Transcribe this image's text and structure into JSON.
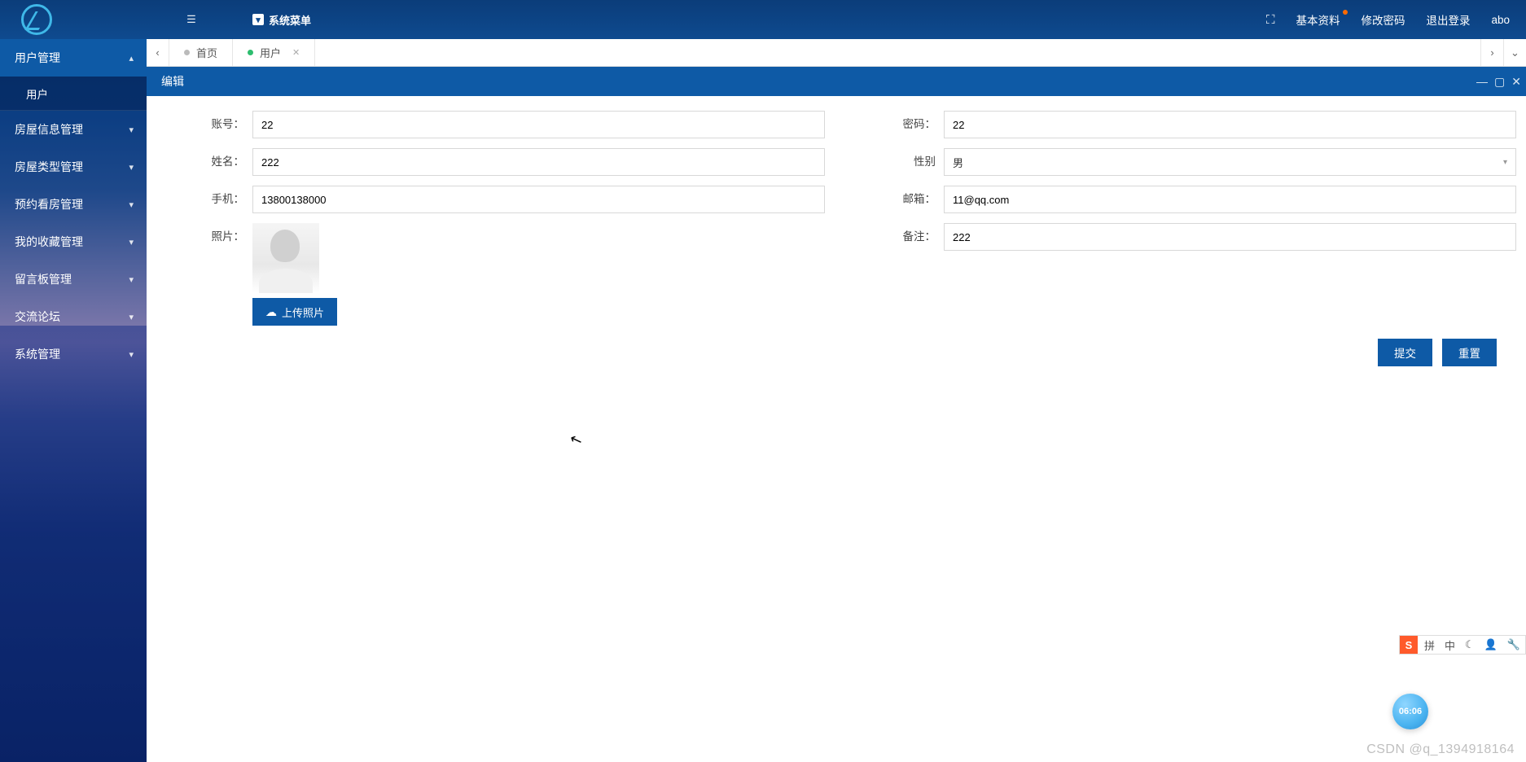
{
  "header": {
    "system_menu": "系统菜单",
    "links": {
      "profile": "基本资料",
      "change_pwd": "修改密码",
      "logout": "退出登录",
      "user": "abo"
    }
  },
  "sidebar": {
    "items": [
      {
        "label": "用户管理",
        "expanded": true,
        "children": [
          {
            "label": "用户"
          }
        ]
      },
      {
        "label": "房屋信息管理"
      },
      {
        "label": "房屋类型管理"
      },
      {
        "label": "预约看房管理"
      },
      {
        "label": "我的收藏管理"
      },
      {
        "label": "留言板管理"
      },
      {
        "label": "交流论坛"
      },
      {
        "label": "系统管理"
      }
    ]
  },
  "tabs": {
    "home": "首页",
    "user": "用户"
  },
  "panel": {
    "title": "编辑"
  },
  "form": {
    "labels": {
      "account": "账号：",
      "password": "密码：",
      "name": "姓名：",
      "gender": "性别",
      "phone": "手机：",
      "email": "邮箱：",
      "photo": "照片：",
      "remark": "备注："
    },
    "values": {
      "account": "22",
      "password": "22",
      "name": "222",
      "gender": "男",
      "phone": "13800138000",
      "email": "11@qq.com",
      "remark": "222"
    },
    "upload": "上传照片",
    "buttons": {
      "submit": "提交",
      "reset": "重置"
    }
  },
  "extras": {
    "clock": "06:06",
    "watermark": "CSDN @q_1394918164",
    "ime": {
      "s": "S",
      "pin": "拼",
      "zh": "中"
    }
  }
}
